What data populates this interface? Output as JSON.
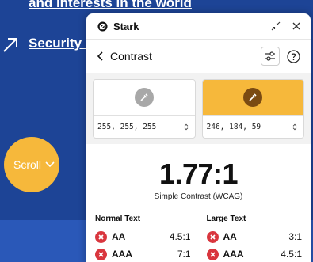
{
  "background": {
    "line1": "and interests in the world",
    "line2": "Security a",
    "scroll_label": "Scroll"
  },
  "panel": {
    "app_title": "Stark",
    "nav_title": "Contrast",
    "foreground": {
      "value": "255, 255, 255",
      "color": "#ffffff"
    },
    "background": {
      "value": "246, 184, 59",
      "color": "#f6b83b"
    },
    "ratio": "1.77:1",
    "ratio_label": "Simple Contrast (WCAG)",
    "normal_text": {
      "heading": "Normal Text",
      "rows": [
        {
          "level": "AA",
          "required": "4.5:1",
          "status": "fail"
        },
        {
          "level": "AAA",
          "required": "7:1",
          "status": "fail"
        }
      ]
    },
    "large_text": {
      "heading": "Large Text",
      "rows": [
        {
          "level": "AA",
          "required": "3:1",
          "status": "fail"
        },
        {
          "level": "AAA",
          "required": "4.5:1",
          "status": "fail"
        }
      ]
    }
  },
  "colors": {
    "page_bg": "#1d4496",
    "accent": "#f6b83b",
    "fail": "#d9363e"
  }
}
